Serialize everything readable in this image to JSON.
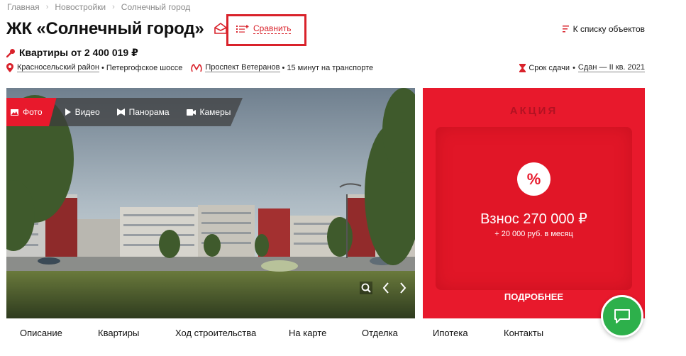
{
  "breadcrumb": [
    "Главная",
    "Новостройки",
    "Солнечный город"
  ],
  "title": "ЖК «Солнечный город»",
  "compare_label": "Сравнить",
  "to_list_label": "К списку объектов",
  "price_label": "Квартиры от 2 400 019 ₽",
  "address": {
    "district": "Красносельский район",
    "street": "Петергофское шоссе",
    "metro": "Проспект Ветеранов",
    "transport": "15 минут на транспорте"
  },
  "deadline": {
    "label": "Срок сдачи",
    "value": "Сдан — II кв. 2021"
  },
  "media_tabs": [
    "Фото",
    "Видео",
    "Панорама",
    "Камеры"
  ],
  "promo": {
    "heading": "АКЦИЯ",
    "badge": "%",
    "title": "Взнос 270 000 ₽",
    "subtitle": "+ 20 000 руб. в месяц",
    "cta": "ПОДРОБНЕЕ"
  },
  "nav_tabs": [
    "Описание",
    "Квартиры",
    "Ход строительства",
    "На карте",
    "Отделка",
    "Ипотека",
    "Контакты"
  ],
  "colors": {
    "accent": "#e8192c",
    "chat": "#2db04b"
  },
  "icons": [
    "share-icon",
    "compare-icon",
    "list-icon",
    "key-icon",
    "location-pin-icon",
    "metro-icon",
    "hourglass-icon",
    "photo-icon",
    "play-icon",
    "panorama-icon",
    "camera-icon",
    "zoom-icon",
    "chat-icon"
  ]
}
